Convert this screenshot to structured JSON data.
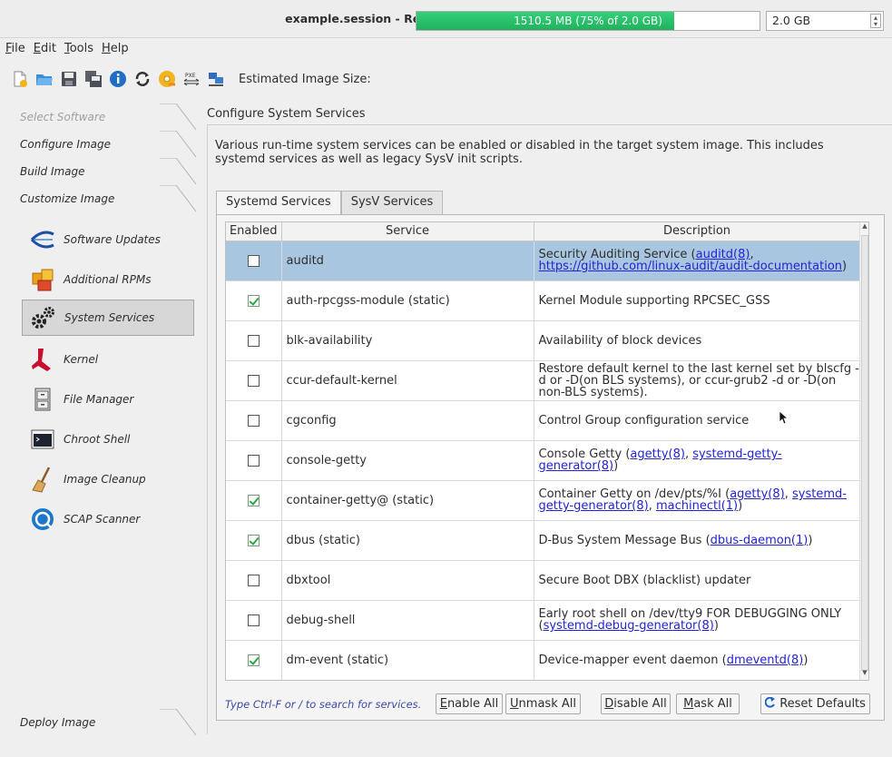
{
  "window": {
    "title": "example.session - RedHawk Architect (on rodrigo)",
    "close_glyph": "×"
  },
  "menubar": {
    "items": [
      {
        "label": "File",
        "mnemonic": "F",
        "rest": "ile"
      },
      {
        "label": "Edit",
        "mnemonic": "E",
        "rest": "dit"
      },
      {
        "label": "Tools",
        "mnemonic": "T",
        "rest": "ools"
      },
      {
        "label": "Help",
        "mnemonic": "H",
        "rest": "elp"
      }
    ]
  },
  "toolbar": {
    "icons": [
      "new-file-icon",
      "open-folder-icon",
      "save-icon",
      "save-as-icon",
      "info-icon",
      "refresh-icon",
      "disc-icon",
      "pxe-icon",
      "network-icon"
    ],
    "pxe_text": "PXE",
    "size_label": "Estimated Image Size:",
    "size_bar_text": "1510.5 MB (75% of 2.0 GB)",
    "size_fraction": 0.75,
    "size_value": "2.0 GB"
  },
  "sidebar": {
    "steps": {
      "select_software": "Select Software",
      "configure_image": "Configure Image",
      "build_image": "Build Image",
      "customize_image": "Customize Image",
      "deploy_image": "Deploy Image"
    },
    "tools": [
      {
        "label": "Software Updates",
        "icon": "software-updates-icon"
      },
      {
        "label": "Additional RPMs",
        "icon": "rpm-packages-icon"
      },
      {
        "label": "System Services",
        "icon": "gears-icon"
      },
      {
        "label": "Kernel",
        "icon": "kernel-icon"
      },
      {
        "label": "File Manager",
        "icon": "file-cabinet-icon"
      },
      {
        "label": "Chroot Shell",
        "icon": "terminal-icon"
      },
      {
        "label": "Image Cleanup",
        "icon": "broom-icon"
      },
      {
        "label": "SCAP Scanner",
        "icon": "scap-scanner-icon"
      }
    ]
  },
  "main": {
    "title": "Configure System Services",
    "description": "Various run-time system services can be enabled or disabled in the target system image.  This includes systemd services as well as legacy SysV init scripts.",
    "tabs": [
      "Systemd Services",
      "SysV Services"
    ],
    "columns": [
      "Enabled",
      "Service",
      "Description"
    ],
    "rows": [
      {
        "enabled": false,
        "service": "auditd",
        "desc_text": "Security Auditing Service (",
        "links": [
          "auditd(8)",
          "https://github.com/linux-audit/audit-documentation"
        ],
        "desc_tail": ")"
      },
      {
        "enabled": true,
        "service": "auth-rpcgss-module (static)",
        "desc_text": "Kernel Module supporting RPCSEC_GSS",
        "links": [],
        "desc_tail": ""
      },
      {
        "enabled": false,
        "service": "blk-availability",
        "desc_text": "Availability of block devices",
        "links": [],
        "desc_tail": ""
      },
      {
        "enabled": false,
        "service": "ccur-default-kernel",
        "desc_text": "Restore default kernel to the last kernel set by blscfg -d or -D(on BLS systems), or ccur-grub2 -d or -D(on non-BLS systems).",
        "links": [],
        "desc_tail": ""
      },
      {
        "enabled": false,
        "service": "cgconfig",
        "desc_text": "Control Group configuration service",
        "links": [],
        "desc_tail": ""
      },
      {
        "enabled": false,
        "service": "console-getty",
        "desc_text": "Console Getty (",
        "links": [
          "agetty(8)",
          "systemd-getty-generator(8)"
        ],
        "desc_tail": ")"
      },
      {
        "enabled": true,
        "service": "container-getty@ (static)",
        "desc_text": "Container Getty on /dev/pts/%I (",
        "links": [
          "agetty(8)",
          "systemd-getty-generator(8)",
          "machinectl(1)"
        ],
        "desc_tail": ")"
      },
      {
        "enabled": true,
        "service": "dbus (static)",
        "desc_text": "D-Bus System Message Bus (",
        "links": [
          "dbus-daemon(1)"
        ],
        "desc_tail": ")"
      },
      {
        "enabled": false,
        "service": "dbxtool",
        "desc_text": "Secure Boot DBX (blacklist) updater",
        "links": [],
        "desc_tail": ""
      },
      {
        "enabled": false,
        "service": "debug-shell",
        "desc_text": "Early root shell on /dev/tty9 FOR DEBUGGING ONLY (",
        "links": [
          "systemd-debug-generator(8)"
        ],
        "desc_tail": ")"
      },
      {
        "enabled": true,
        "service": "dm-event (static)",
        "desc_text": "Device-mapper event daemon (",
        "links": [
          "dmeventd(8)"
        ],
        "desc_tail": ")"
      }
    ],
    "selected_row": 0,
    "hint": "Type Ctrl-F or / to search for services.",
    "buttons": {
      "enable_all": {
        "mn": "E",
        "rest": "nable All"
      },
      "unmask_all": {
        "mn": "U",
        "rest": "nmask All"
      },
      "disable_all": {
        "mn": "D",
        "rest": "isable All"
      },
      "mask_all": {
        "mn": "M",
        "rest": "ask All"
      },
      "reset_defaults": "Reset Defaults"
    }
  }
}
